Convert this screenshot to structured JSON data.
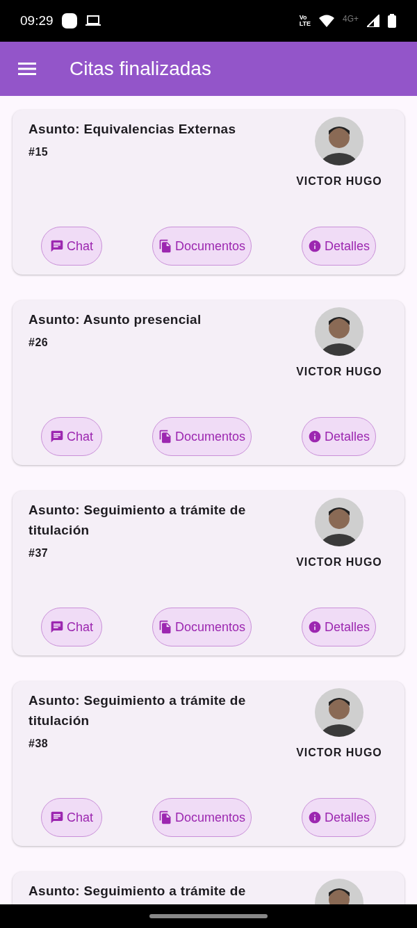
{
  "status_bar": {
    "time": "09:29",
    "volte_top": "Vo",
    "volte_bottom": "LTE",
    "network": "4G+"
  },
  "app_bar": {
    "title": "Citas finalizadas"
  },
  "appointments": [
    {
      "subject": "Asunto: Equivalencias Externas",
      "number": "#15",
      "person": "VICTOR HUGO",
      "actions": [
        {
          "kind": "chat",
          "label": "Chat"
        },
        {
          "kind": "documents",
          "label": "Documentos"
        },
        {
          "kind": "details",
          "label": "Detalles"
        }
      ]
    },
    {
      "subject": "Asunto: Asunto presencial",
      "number": "#26",
      "person": "VICTOR HUGO",
      "actions": [
        {
          "kind": "chat",
          "label": "Chat"
        },
        {
          "kind": "documents",
          "label": "Documentos"
        },
        {
          "kind": "details",
          "label": "Detalles"
        }
      ]
    },
    {
      "subject": "Asunto: Seguimiento a trámite de titulación",
      "number": "#37",
      "person": "VICTOR HUGO",
      "actions": [
        {
          "kind": "chat",
          "label": "Chat"
        },
        {
          "kind": "documents",
          "label": "Documentos"
        },
        {
          "kind": "details",
          "label": "Detalles"
        }
      ]
    },
    {
      "subject": "Asunto: Seguimiento a trámite de titulación",
      "number": "#38",
      "person": "VICTOR HUGO",
      "actions": [
        {
          "kind": "chat",
          "label": "Chat"
        },
        {
          "kind": "documents",
          "label": "Documentos"
        },
        {
          "kind": "details",
          "label": "Detalles"
        }
      ]
    },
    {
      "subject": "Asunto: Seguimiento a trámite de"
    }
  ]
}
